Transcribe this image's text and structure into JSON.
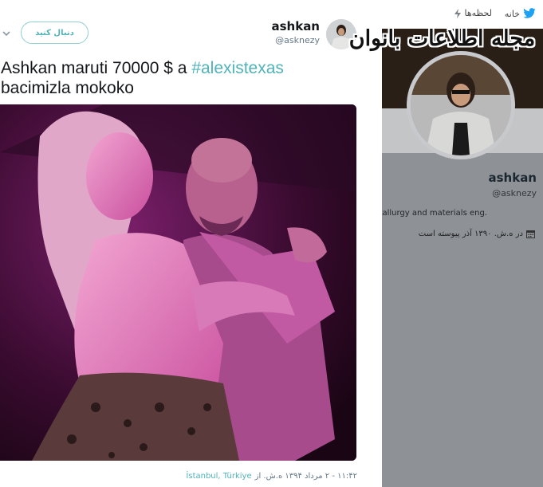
{
  "background_profile": {
    "nav": {
      "home_label": "خانه",
      "moments_label": "لحظه‌ها"
    },
    "name": "ashkan",
    "handle": "@asknezy",
    "bio_fragment": "tallurgy and materials eng.",
    "joined_text": "در ه.ش. ۱۳۹۰ آذر پیوسته است"
  },
  "watermark": {
    "text": "مجله اطلاعات بانوان"
  },
  "tweet": {
    "follow_label": "دنبال کنید",
    "author_name": "ashkan",
    "author_handle": "@asknezy",
    "text_before": "Ashkan maruti 70000 $ a ",
    "hashtag": "#alexistexas",
    "text_after": "bacimizla mokoko",
    "timestamp": "۱۱:۴۲ - ۲ مرداد ۱۳۹۴ ه.ش. از",
    "location": "İstanbul, Türkiye"
  },
  "colors": {
    "accent": "#4fb3b8",
    "text": "#14171a",
    "muted": "#657786",
    "twitter_blue": "#1da1f2"
  },
  "icons": [
    "twitter-bird-icon",
    "lightning-icon",
    "calendar-icon",
    "chevron-down-icon"
  ]
}
